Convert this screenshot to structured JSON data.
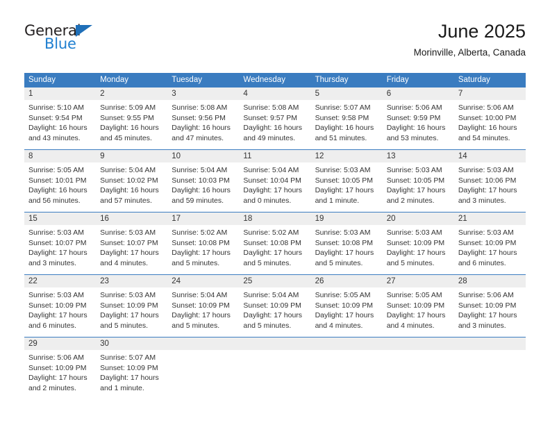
{
  "brand": {
    "name_top": "General",
    "name_bottom": "Blue",
    "triangle_color": "#1f6fb8",
    "blue_color": "#1f7fd0"
  },
  "header": {
    "title": "June 2025",
    "subtitle": "Morinville, Alberta, Canada"
  },
  "theme": {
    "header_blue": "#3a7cc0",
    "daynum_gray": "#eeeeee",
    "text": "#333333"
  },
  "weekdays": [
    "Sunday",
    "Monday",
    "Tuesday",
    "Wednesday",
    "Thursday",
    "Friday",
    "Saturday"
  ],
  "weeks": [
    {
      "days": [
        {
          "num": "1",
          "sunrise": "Sunrise: 5:10 AM",
          "sunset": "Sunset: 9:54 PM",
          "daylight1": "Daylight: 16 hours",
          "daylight2": "and 43 minutes."
        },
        {
          "num": "2",
          "sunrise": "Sunrise: 5:09 AM",
          "sunset": "Sunset: 9:55 PM",
          "daylight1": "Daylight: 16 hours",
          "daylight2": "and 45 minutes."
        },
        {
          "num": "3",
          "sunrise": "Sunrise: 5:08 AM",
          "sunset": "Sunset: 9:56 PM",
          "daylight1": "Daylight: 16 hours",
          "daylight2": "and 47 minutes."
        },
        {
          "num": "4",
          "sunrise": "Sunrise: 5:08 AM",
          "sunset": "Sunset: 9:57 PM",
          "daylight1": "Daylight: 16 hours",
          "daylight2": "and 49 minutes."
        },
        {
          "num": "5",
          "sunrise": "Sunrise: 5:07 AM",
          "sunset": "Sunset: 9:58 PM",
          "daylight1": "Daylight: 16 hours",
          "daylight2": "and 51 minutes."
        },
        {
          "num": "6",
          "sunrise": "Sunrise: 5:06 AM",
          "sunset": "Sunset: 9:59 PM",
          "daylight1": "Daylight: 16 hours",
          "daylight2": "and 53 minutes."
        },
        {
          "num": "7",
          "sunrise": "Sunrise: 5:06 AM",
          "sunset": "Sunset: 10:00 PM",
          "daylight1": "Daylight: 16 hours",
          "daylight2": "and 54 minutes."
        }
      ]
    },
    {
      "days": [
        {
          "num": "8",
          "sunrise": "Sunrise: 5:05 AM",
          "sunset": "Sunset: 10:01 PM",
          "daylight1": "Daylight: 16 hours",
          "daylight2": "and 56 minutes."
        },
        {
          "num": "9",
          "sunrise": "Sunrise: 5:04 AM",
          "sunset": "Sunset: 10:02 PM",
          "daylight1": "Daylight: 16 hours",
          "daylight2": "and 57 minutes."
        },
        {
          "num": "10",
          "sunrise": "Sunrise: 5:04 AM",
          "sunset": "Sunset: 10:03 PM",
          "daylight1": "Daylight: 16 hours",
          "daylight2": "and 59 minutes."
        },
        {
          "num": "11",
          "sunrise": "Sunrise: 5:04 AM",
          "sunset": "Sunset: 10:04 PM",
          "daylight1": "Daylight: 17 hours",
          "daylight2": "and 0 minutes."
        },
        {
          "num": "12",
          "sunrise": "Sunrise: 5:03 AM",
          "sunset": "Sunset: 10:05 PM",
          "daylight1": "Daylight: 17 hours",
          "daylight2": "and 1 minute."
        },
        {
          "num": "13",
          "sunrise": "Sunrise: 5:03 AM",
          "sunset": "Sunset: 10:05 PM",
          "daylight1": "Daylight: 17 hours",
          "daylight2": "and 2 minutes."
        },
        {
          "num": "14",
          "sunrise": "Sunrise: 5:03 AM",
          "sunset": "Sunset: 10:06 PM",
          "daylight1": "Daylight: 17 hours",
          "daylight2": "and 3 minutes."
        }
      ]
    },
    {
      "days": [
        {
          "num": "15",
          "sunrise": "Sunrise: 5:03 AM",
          "sunset": "Sunset: 10:07 PM",
          "daylight1": "Daylight: 17 hours",
          "daylight2": "and 3 minutes."
        },
        {
          "num": "16",
          "sunrise": "Sunrise: 5:03 AM",
          "sunset": "Sunset: 10:07 PM",
          "daylight1": "Daylight: 17 hours",
          "daylight2": "and 4 minutes."
        },
        {
          "num": "17",
          "sunrise": "Sunrise: 5:02 AM",
          "sunset": "Sunset: 10:08 PM",
          "daylight1": "Daylight: 17 hours",
          "daylight2": "and 5 minutes."
        },
        {
          "num": "18",
          "sunrise": "Sunrise: 5:02 AM",
          "sunset": "Sunset: 10:08 PM",
          "daylight1": "Daylight: 17 hours",
          "daylight2": "and 5 minutes."
        },
        {
          "num": "19",
          "sunrise": "Sunrise: 5:03 AM",
          "sunset": "Sunset: 10:08 PM",
          "daylight1": "Daylight: 17 hours",
          "daylight2": "and 5 minutes."
        },
        {
          "num": "20",
          "sunrise": "Sunrise: 5:03 AM",
          "sunset": "Sunset: 10:09 PM",
          "daylight1": "Daylight: 17 hours",
          "daylight2": "and 5 minutes."
        },
        {
          "num": "21",
          "sunrise": "Sunrise: 5:03 AM",
          "sunset": "Sunset: 10:09 PM",
          "daylight1": "Daylight: 17 hours",
          "daylight2": "and 6 minutes."
        }
      ]
    },
    {
      "days": [
        {
          "num": "22",
          "sunrise": "Sunrise: 5:03 AM",
          "sunset": "Sunset: 10:09 PM",
          "daylight1": "Daylight: 17 hours",
          "daylight2": "and 6 minutes."
        },
        {
          "num": "23",
          "sunrise": "Sunrise: 5:03 AM",
          "sunset": "Sunset: 10:09 PM",
          "daylight1": "Daylight: 17 hours",
          "daylight2": "and 5 minutes."
        },
        {
          "num": "24",
          "sunrise": "Sunrise: 5:04 AM",
          "sunset": "Sunset: 10:09 PM",
          "daylight1": "Daylight: 17 hours",
          "daylight2": "and 5 minutes."
        },
        {
          "num": "25",
          "sunrise": "Sunrise: 5:04 AM",
          "sunset": "Sunset: 10:09 PM",
          "daylight1": "Daylight: 17 hours",
          "daylight2": "and 5 minutes."
        },
        {
          "num": "26",
          "sunrise": "Sunrise: 5:05 AM",
          "sunset": "Sunset: 10:09 PM",
          "daylight1": "Daylight: 17 hours",
          "daylight2": "and 4 minutes."
        },
        {
          "num": "27",
          "sunrise": "Sunrise: 5:05 AM",
          "sunset": "Sunset: 10:09 PM",
          "daylight1": "Daylight: 17 hours",
          "daylight2": "and 4 minutes."
        },
        {
          "num": "28",
          "sunrise": "Sunrise: 5:06 AM",
          "sunset": "Sunset: 10:09 PM",
          "daylight1": "Daylight: 17 hours",
          "daylight2": "and 3 minutes."
        }
      ]
    },
    {
      "days": [
        {
          "num": "29",
          "sunrise": "Sunrise: 5:06 AM",
          "sunset": "Sunset: 10:09 PM",
          "daylight1": "Daylight: 17 hours",
          "daylight2": "and 2 minutes."
        },
        {
          "num": "30",
          "sunrise": "Sunrise: 5:07 AM",
          "sunset": "Sunset: 10:09 PM",
          "daylight1": "Daylight: 17 hours",
          "daylight2": "and 1 minute."
        },
        {
          "num": "",
          "sunrise": "",
          "sunset": "",
          "daylight1": "",
          "daylight2": ""
        },
        {
          "num": "",
          "sunrise": "",
          "sunset": "",
          "daylight1": "",
          "daylight2": ""
        },
        {
          "num": "",
          "sunrise": "",
          "sunset": "",
          "daylight1": "",
          "daylight2": ""
        },
        {
          "num": "",
          "sunrise": "",
          "sunset": "",
          "daylight1": "",
          "daylight2": ""
        },
        {
          "num": "",
          "sunrise": "",
          "sunset": "",
          "daylight1": "",
          "daylight2": ""
        }
      ]
    }
  ]
}
